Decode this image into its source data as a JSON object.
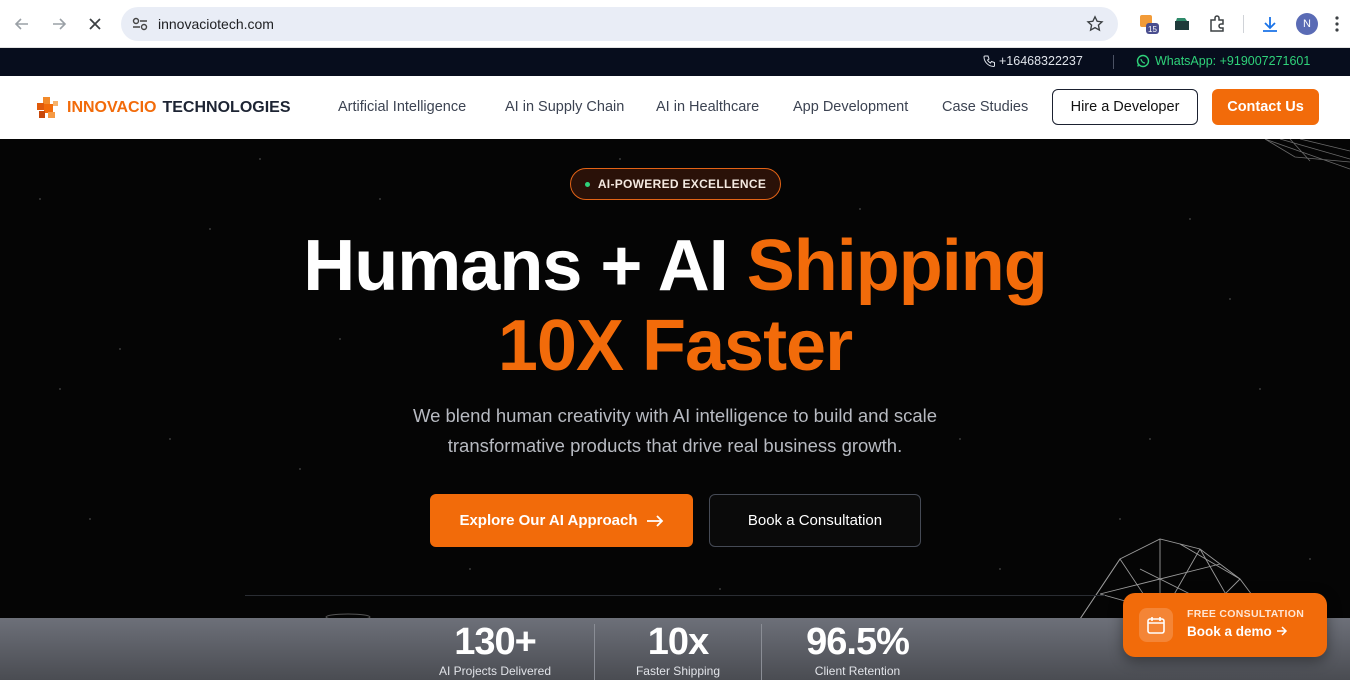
{
  "browser": {
    "url": "innovaciotech.com",
    "badge_count": "15",
    "profile_initial": "N"
  },
  "topbar": {
    "phone": "+16468322237",
    "whatsapp": "WhatsApp: +919007271601"
  },
  "nav": {
    "brand_part1": "INNOVACIO",
    "brand_part2": "TECHNOLOGIES",
    "items": [
      "Artificial Intelligence",
      "AI in Supply Chain",
      "AI in Healthcare",
      "App Development",
      "Case Studies"
    ],
    "hire_label": "Hire a Developer",
    "contact_label": "Contact Us"
  },
  "hero": {
    "badge": "AI-POWERED EXCELLENCE",
    "headline_white": "Humans + AI",
    "headline_orange": "Shipping",
    "headline_line2": "10X Faster",
    "subtitle_line1": "We blend human creativity with AI intelligence to build and scale",
    "subtitle_line2": "transformative products that drive real business growth.",
    "cta_primary": "Explore Our AI Approach",
    "cta_secondary": "Book a Consultation"
  },
  "stats": [
    {
      "value": "130+",
      "label": "AI Projects Delivered"
    },
    {
      "value": "10x",
      "label": "Faster Shipping"
    },
    {
      "value": "96.5%",
      "label": "Client Retention"
    }
  ],
  "floating_cta": {
    "kicker": "FREE CONSULTATION",
    "label": "Book a demo"
  },
  "colors": {
    "brand_orange": "#f26b0a",
    "topbar_bg": "#070d1d",
    "whatsapp_green": "#2fd27a",
    "hero_bg": "#050505"
  }
}
